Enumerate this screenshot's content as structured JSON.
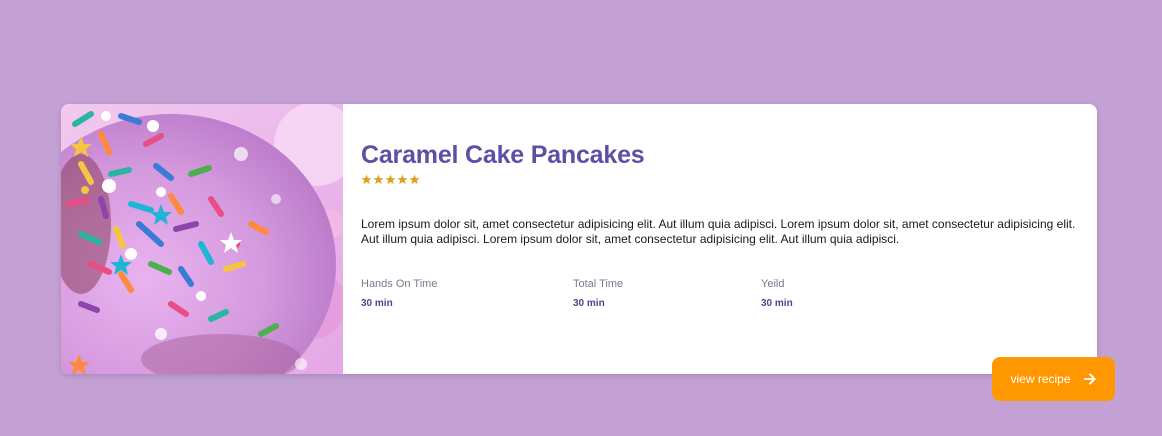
{
  "card": {
    "image_alt": "Pink frosted donut with rainbow sprinkles",
    "title": "Caramel Cake Pancakes",
    "rating": 5,
    "rating_color": "#d9a520",
    "description": "Lorem ipsum dolor sit, amet consectetur adipisicing elit. Aut illum quia adipisci. Lorem ipsum dolor sit, amet consectetur adipisicing elit. Aut illum quia adipisci. Lorem ipsum dolor sit, amet consectetur adipisicing elit. Aut illum quia adipisci.",
    "stats": [
      {
        "label": "Hands On Time",
        "value": "30 min"
      },
      {
        "label": "Total Time",
        "value": "30 min"
      },
      {
        "label": "Yeild",
        "value": "30 min"
      }
    ]
  },
  "button": {
    "label": "view recipe",
    "icon": "arrow-right-icon",
    "color": "#ff9800"
  },
  "colors": {
    "background": "#c4a1d4",
    "title": "#5d4fa6",
    "stat_value": "#4f458f"
  }
}
